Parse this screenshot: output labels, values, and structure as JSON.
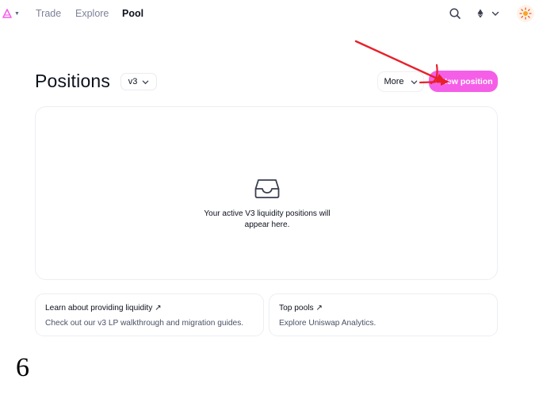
{
  "nav": {
    "links": [
      {
        "label": "Trade"
      },
      {
        "label": "Explore"
      },
      {
        "label": "Pool"
      }
    ],
    "active_link": "Pool",
    "icons": {
      "logo": "uniswap-logo-icon",
      "search": "search-icon",
      "chain": "ethereum-icon",
      "account": "sun-avatar-icon"
    }
  },
  "header": {
    "title": "Positions",
    "version_selected": "v3",
    "more_label": "More",
    "new_position_label": "+ New position",
    "new_position_visible": "w position"
  },
  "empty_state": {
    "icon": "inbox-icon",
    "line1": "Your active V3 liquidity positions will",
    "line2": "appear here."
  },
  "cards": [
    {
      "title": "Learn about providing liquidity ↗",
      "description": "Check out our v3 LP walkthrough and migration guides."
    },
    {
      "title": "Top pools ↗",
      "description": "Explore Uniswap Analytics."
    }
  ],
  "annotation": {
    "step_number": "6",
    "arrow_color": "#e8202a"
  },
  "colors": {
    "accent": "#f55fe8",
    "text_primary": "#0d111c",
    "text_secondary": "#7d8299",
    "border": "#eceef3"
  }
}
